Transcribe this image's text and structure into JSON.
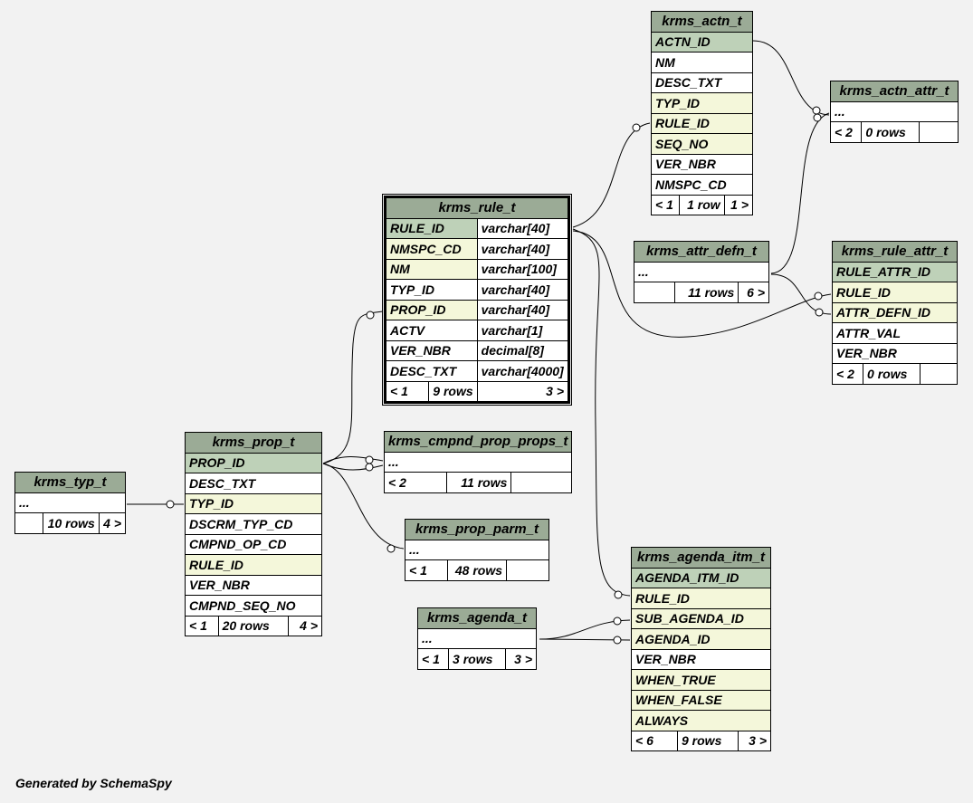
{
  "tables": {
    "krms_actn_t": {
      "title": "krms_actn_t",
      "columns": [
        "ACTN_ID",
        "NM",
        "DESC_TXT",
        "TYP_ID",
        "RULE_ID",
        "SEQ_NO",
        "VER_NBR",
        "NMSPC_CD"
      ],
      "footer": [
        "< 1",
        "1 row",
        "1 >"
      ]
    },
    "krms_actn_attr_t": {
      "title": "krms_actn_attr_t",
      "columns": [
        "..."
      ],
      "footer": [
        "< 2",
        "0 rows",
        ""
      ]
    },
    "krms_rule_t": {
      "title": "krms_rule_t",
      "columns": [
        "RULE_ID",
        "NMSPC_CD",
        "NM",
        "TYP_ID",
        "PROP_ID",
        "ACTV",
        "VER_NBR",
        "DESC_TXT"
      ],
      "types": [
        "varchar[40]",
        "varchar[40]",
        "varchar[100]",
        "varchar[40]",
        "varchar[40]",
        "varchar[1]",
        "decimal[8]",
        "varchar[4000]"
      ],
      "footer": [
        "< 1",
        "9 rows",
        "3 >"
      ]
    },
    "krms_attr_defn_t": {
      "title": "krms_attr_defn_t",
      "columns": [
        "..."
      ],
      "footer": [
        "",
        "11 rows",
        "6 >"
      ]
    },
    "krms_rule_attr_t": {
      "title": "krms_rule_attr_t",
      "columns": [
        "RULE_ATTR_ID",
        "RULE_ID",
        "ATTR_DEFN_ID",
        "ATTR_VAL",
        "VER_NBR"
      ],
      "footer": [
        "< 2",
        "0 rows",
        ""
      ]
    },
    "krms_typ_t": {
      "title": "krms_typ_t",
      "columns": [
        "..."
      ],
      "footer": [
        "",
        "10 rows",
        "4 >"
      ]
    },
    "krms_prop_t": {
      "title": "krms_prop_t",
      "columns": [
        "PROP_ID",
        "DESC_TXT",
        "TYP_ID",
        "DSCRM_TYP_CD",
        "CMPND_OP_CD",
        "RULE_ID",
        "VER_NBR",
        "CMPND_SEQ_NO"
      ],
      "footer": [
        "< 1",
        "20 rows",
        "4 >"
      ]
    },
    "krms_cmpnd_prop_props_t": {
      "title": "krms_cmpnd_prop_props_t",
      "columns": [
        "..."
      ],
      "footer": [
        "< 2",
        "11 rows",
        ""
      ]
    },
    "krms_prop_parm_t": {
      "title": "krms_prop_parm_t",
      "columns": [
        "..."
      ],
      "footer": [
        "< 1",
        "48 rows",
        ""
      ]
    },
    "krms_agenda_t": {
      "title": "krms_agenda_t",
      "columns": [
        "..."
      ],
      "footer": [
        "< 1",
        "3 rows",
        "3 >"
      ]
    },
    "krms_agenda_itm_t": {
      "title": "krms_agenda_itm_t",
      "columns": [
        "AGENDA_ITM_ID",
        "RULE_ID",
        "SUB_AGENDA_ID",
        "AGENDA_ID",
        "VER_NBR",
        "WHEN_TRUE",
        "WHEN_FALSE",
        "ALWAYS"
      ],
      "footer": [
        "< 6",
        "9 rows",
        "3 >"
      ]
    }
  },
  "footer_text": "Generated by SchemaSpy",
  "colors": {
    "background": "#f2f2f2",
    "title_bg": "#9bab96",
    "primary_key_bg": "#bed1b8",
    "foreign_key_bg": "#f4f7da",
    "cell_bg": "#ffffff"
  }
}
